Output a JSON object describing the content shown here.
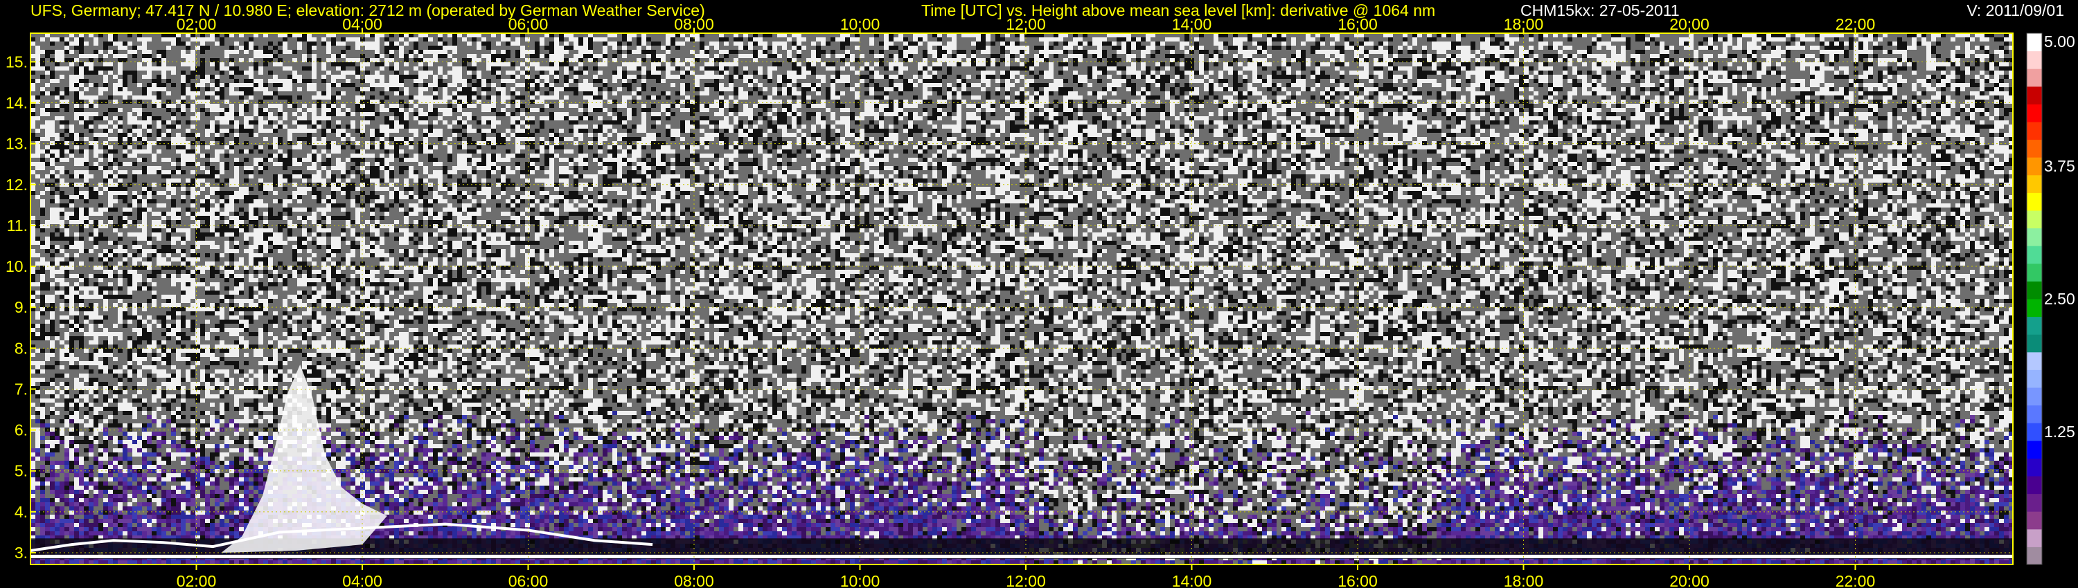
{
  "header": {
    "left": "UFS, Germany; 47.417 N / 10.980 E; elevation: 2712 m  (operated by German Weather Service)",
    "center": "Time [UTC] vs. Height above mean sea level [km]: derivative @ 1064 nm",
    "right": "CHM15kx: 27-05-2011",
    "version": "V: 2011/09/01"
  },
  "colors": {
    "label": "#ffff00",
    "grid": "#c8c800",
    "background": "#000000"
  },
  "chart_data": {
    "type": "heatmap",
    "title": "",
    "xlabel": "",
    "ylabel": "",
    "xlim": [
      0.0,
      23.9
    ],
    "ylim": [
      2.712,
      15.7
    ],
    "grid": true,
    "x_ticks": [
      2,
      4,
      6,
      8,
      10,
      12,
      14,
      16,
      18,
      20,
      22
    ],
    "x_tick_labels": [
      "02:00",
      "04:00",
      "06:00",
      "08:00",
      "10:00",
      "12:00",
      "14:00",
      "16:00",
      "18:00",
      "20:00",
      "22:00"
    ],
    "y_ticks": [
      3,
      4,
      5,
      6,
      7,
      8,
      9,
      10,
      11,
      12,
      13,
      14,
      15
    ],
    "y_tick_labels": [
      "3.",
      "4.",
      "5.",
      "6.",
      "7.",
      "8.",
      "9.",
      "10.",
      "11.",
      "12.",
      "13.",
      "14.",
      "15."
    ],
    "colorbar": {
      "range": [
        0,
        5.0
      ],
      "ticks": [
        1.25,
        2.5,
        3.75,
        5.0
      ],
      "tick_labels": [
        "1.25",
        "2.50",
        "3.75",
        "5.00"
      ],
      "colors": [
        "#a08ca0",
        "#c8a0c8",
        "#8c3c8c",
        "#6a1f8c",
        "#4a0090",
        "#2800c8",
        "#0000ff",
        "#3050ff",
        "#5a78ff",
        "#7896ff",
        "#96b4ff",
        "#b4c8ff",
        "#0a8c78",
        "#14a08c",
        "#00b400",
        "#008c00",
        "#32c864",
        "#50dc96",
        "#8cf0a0",
        "#c8ff64",
        "#ffff00",
        "#ffc800",
        "#ff9600",
        "#ff6400",
        "#ff3200",
        "#ff0000",
        "#c80000",
        "#f0a0a0",
        "#ffd2d2",
        "#ffffff"
      ]
    }
  }
}
